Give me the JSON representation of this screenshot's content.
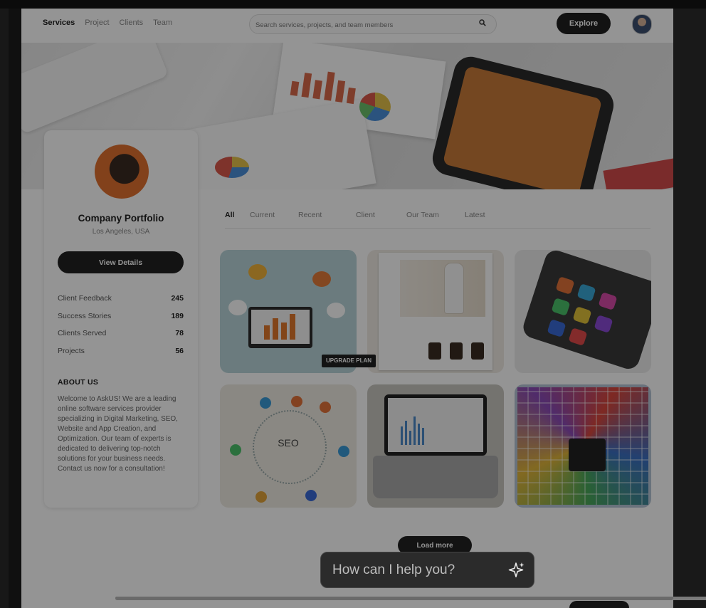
{
  "header": {
    "nav": [
      "Services",
      "Project",
      "Clients",
      "Team"
    ],
    "search_placeholder": "Search services, projects, and team members",
    "explore_label": "Explore"
  },
  "profile": {
    "name": "Company Portfolio",
    "location": "Los Angeles, USA",
    "view_details_label": "View Details",
    "stats": [
      {
        "label": "Client Feedback",
        "value": "245"
      },
      {
        "label": "Success Stories",
        "value": "189"
      },
      {
        "label": "Clients Served",
        "value": "78"
      },
      {
        "label": "Projects",
        "value": "56"
      }
    ],
    "about_heading": "ABOUT US",
    "about_text": "Welcome to AskUS! We are a leading online software services provider specializing in Digital Marketing, SEO, Website and App Creation, and Optimization. Our team of experts is dedicated to delivering top-notch solutions for your business needs. Contact us now for a consultation!"
  },
  "filters": [
    "All",
    "Current",
    "Recent",
    "Client",
    "Our Team",
    "Latest"
  ],
  "gallery": {
    "seo_label": "SEO",
    "upgrade_label": "UPGRADE PLAN"
  },
  "load_more_label": "Load more",
  "assistant": {
    "placeholder": "How can I help you?"
  },
  "colors": {
    "accent": "#222222",
    "overlay": "rgba(0,0,0,0.42)"
  }
}
